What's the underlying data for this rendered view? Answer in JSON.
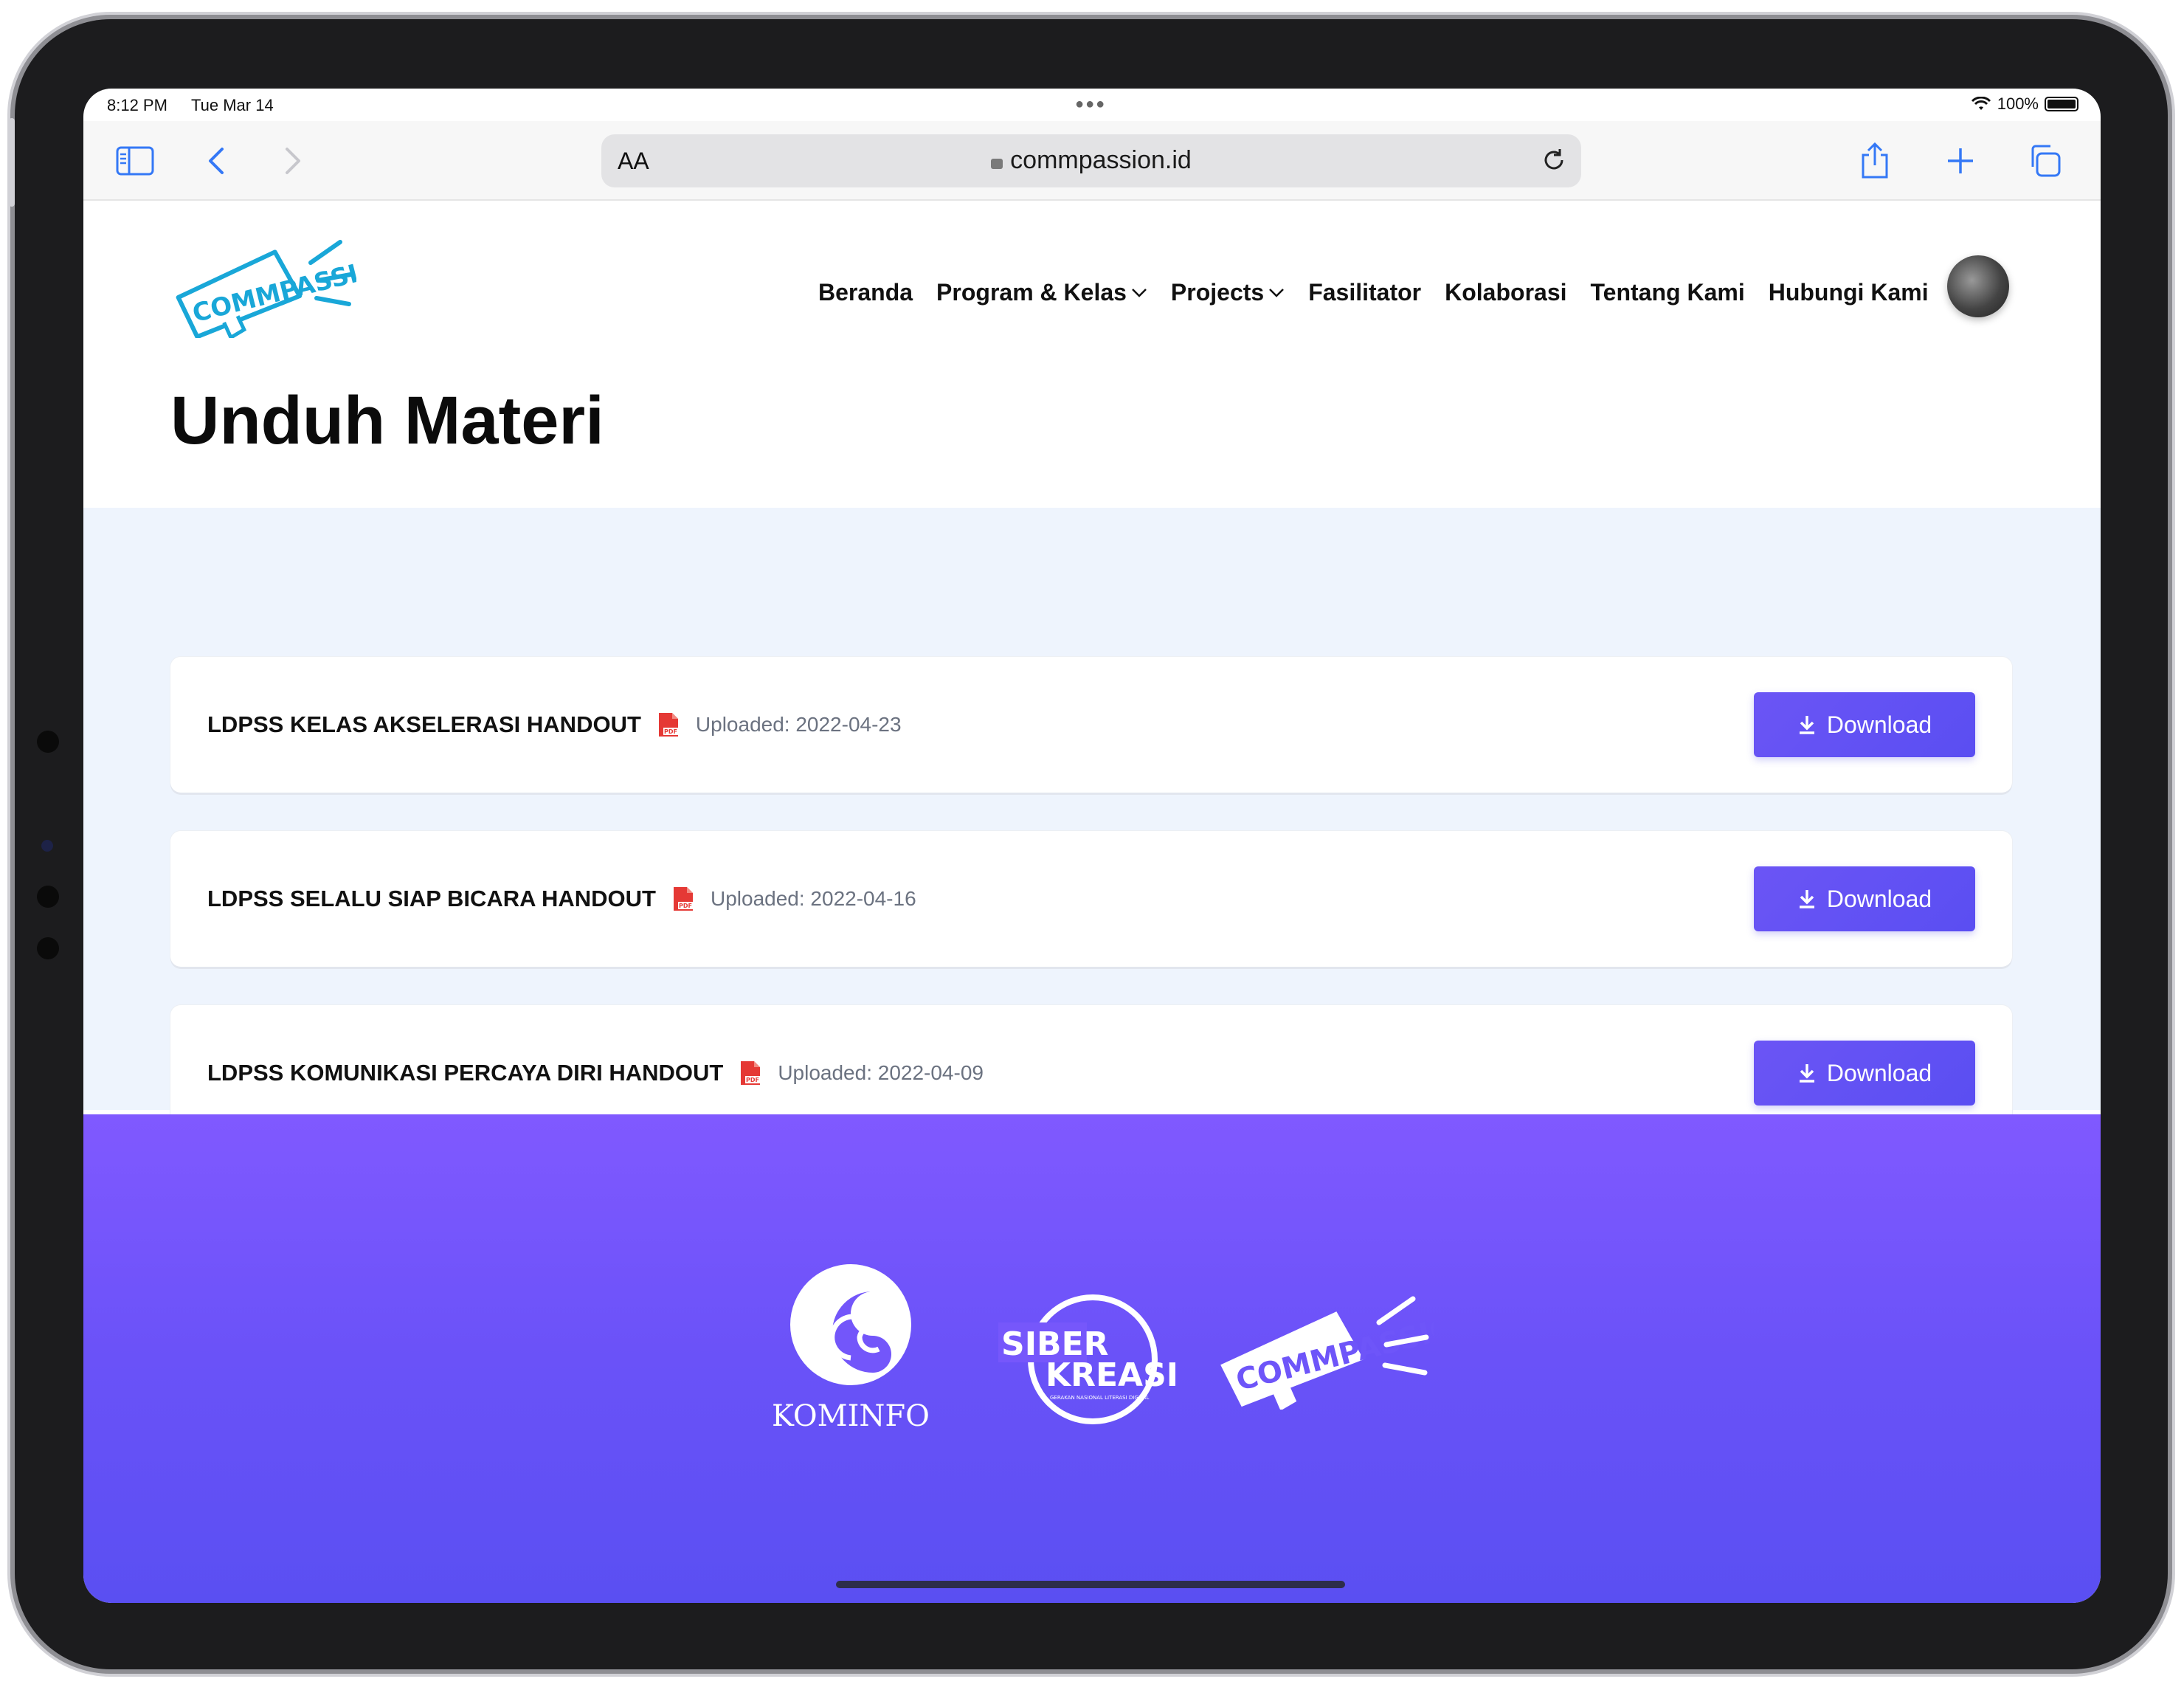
{
  "status": {
    "time": "8:12 PM",
    "date": "Tue Mar 14",
    "battery": "100%"
  },
  "browser": {
    "aa_label": "AA",
    "url": "commpassion.id"
  },
  "site": {
    "logo_text": "COMMPASSION",
    "nav": [
      {
        "label": "Beranda",
        "dropdown": false
      },
      {
        "label": "Program & Kelas",
        "dropdown": true
      },
      {
        "label": "Projects",
        "dropdown": true
      },
      {
        "label": "Fasilitator",
        "dropdown": false
      },
      {
        "label": "Kolaborasi",
        "dropdown": false
      },
      {
        "label": "Tentang Kami",
        "dropdown": false
      },
      {
        "label": "Hubungi Kami",
        "dropdown": false
      }
    ]
  },
  "page": {
    "title": "Unduh Materi"
  },
  "materials": [
    {
      "title": "LDPSS KELAS AKSELERASI HANDOUT",
      "uploaded": "Uploaded: 2022-04-23",
      "button": "Download"
    },
    {
      "title": "LDPSS SELALU SIAP BICARA HANDOUT",
      "uploaded": "Uploaded: 2022-04-16",
      "button": "Download"
    },
    {
      "title": "LDPSS KOMUNIKASI PERCAYA DIRI HANDOUT",
      "uploaded": "Uploaded: 2022-04-09",
      "button": "Download"
    }
  ],
  "footer": {
    "logos": [
      {
        "name": "KOMINFO",
        "text": "KOMINFO"
      },
      {
        "name": "SIBERKREASI",
        "text_top": "SIBER",
        "text_bottom": "KREASI",
        "small": "GERAKAN NASIONAL LITERASI DIGITAL"
      },
      {
        "name": "COMMPASSION",
        "text": "COMMPASSION"
      }
    ]
  },
  "colors": {
    "accent": "#5b4ff2",
    "footer_top": "#8059ff",
    "pdf_red": "#e53935",
    "logo_cyan": "#19a7d8"
  }
}
